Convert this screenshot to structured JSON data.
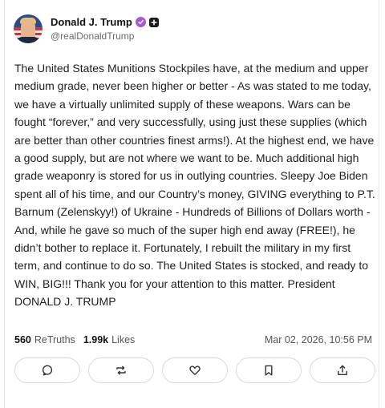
{
  "author": {
    "display_name": "Donald J. Trump",
    "handle": "@realDonaldTrump",
    "avatar_icon": "profile-photo",
    "verified_color": "#a35ad4"
  },
  "post": {
    "text": "The United States Munitions Stockpiles have, at the medium and upper medium grade, never been higher or better - As was stated to me today, we have a virtually unlimited supply of these weapons. Wars can be fought “forever,” and very successfully, using just these supplies (which are better than other countries finest arms!). At the highest end, we have a good supply, but are not where we want to be. Much additional high grade weaponry is stored for us in outlying countries. Sleepy Joe Biden spent all of his time, and our Country’s money, GIVING everything to P.T. Barnum (Zelenskyy!) of Ukraine - Hundreds of Billions of Dollars worth - And, while he gave so much of the super high end away (FREE!), he didn’t bother to replace it. Fortunately, I rebuilt the military in my first term, and continue to do so. The United States is stocked, and ready to WIN, BIG!!! Thank you for your attention to this matter. President DONALD J. TRUMP"
  },
  "stats": {
    "retruths_count": "560",
    "retruths_label": "ReTruths",
    "likes_count": "1.99k",
    "likes_label": "Likes",
    "timestamp": "Mar 02, 2026, 10:56 PM"
  },
  "actions": [
    {
      "icon": "reply-icon"
    },
    {
      "icon": "retruth-icon"
    },
    {
      "icon": "heart-icon"
    },
    {
      "icon": "bookmark-icon"
    },
    {
      "icon": "share-icon"
    }
  ]
}
